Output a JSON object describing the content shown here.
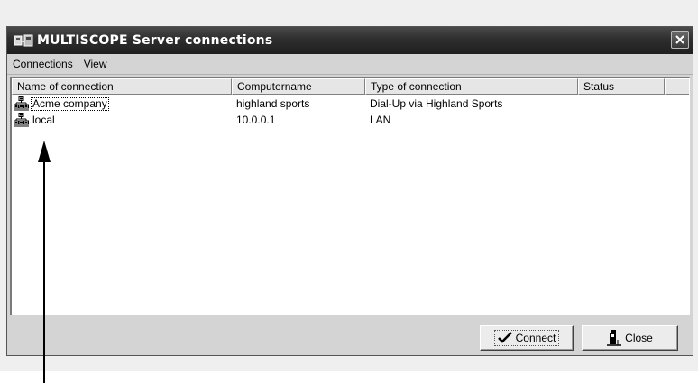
{
  "window": {
    "title": "MULTISCOPE Server connections"
  },
  "menu": {
    "items": [
      "Connections",
      "View"
    ]
  },
  "table": {
    "columns": [
      "Name of connection",
      "Computername",
      "Type of connection",
      "Status"
    ],
    "rows": [
      {
        "name": "Acme company",
        "computer": "highland sports",
        "type": "Dial-Up via Highland Sports",
        "status": ""
      },
      {
        "name": "local",
        "computer": "10.0.0.1",
        "type": "LAN",
        "status": ""
      }
    ]
  },
  "buttons": {
    "connect_label": "Connect",
    "close_label": "Close"
  },
  "icons": {
    "app": "server-connections-icon",
    "row": "network-icon",
    "connect": "checkmark-icon",
    "close": "door-icon",
    "titlebar_close": "close-icon"
  },
  "colors": {
    "titlebar": "#2e2e2e",
    "window_bg": "#d4d4d4",
    "list_bg": "#ffffff"
  }
}
